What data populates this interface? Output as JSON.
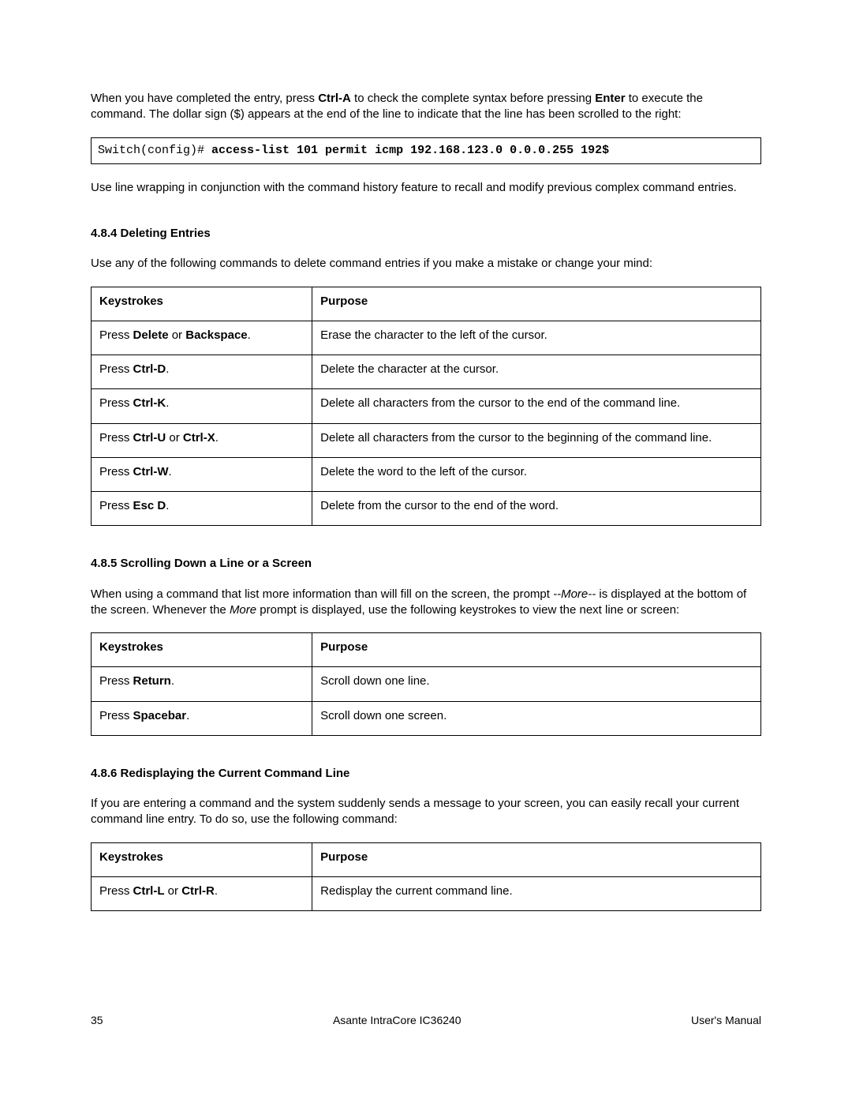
{
  "intro": {
    "p1_pre": "When you have completed the entry, press ",
    "p1_key1": "Ctrl-A",
    "p1_mid": " to check the complete syntax before pressing ",
    "p1_key2": "Enter",
    "p1_post": " to execute the command. The dollar sign ($) appears at the end of the line to indicate that the line has been scrolled to the right:"
  },
  "codebox": {
    "prompt": "Switch(config)# ",
    "command": "access-list 101 permit icmp 192.168.123.0 0.0.0.255 192$"
  },
  "after_code": " Use line wrapping in conjunction with the command history feature to recall and modify previous complex command entries.",
  "section484": {
    "heading": "4.8.4 Deleting Entries",
    "intro": "Use any of the following commands to delete command entries if you make a mistake or change your mind:",
    "headers": {
      "k": "Keystrokes",
      "p": "Purpose"
    },
    "rows": [
      {
        "k_pre": "Press ",
        "k_bold": "Delete",
        "k_mid": " or ",
        "k_bold2": "Backspace",
        "k_post": ".",
        "purpose": "Erase the character to the left of the cursor."
      },
      {
        "k_pre": "Press ",
        "k_bold": "Ctrl-D",
        "k_mid": "",
        "k_bold2": "",
        "k_post": ".",
        "purpose": "Delete the character at the cursor."
      },
      {
        "k_pre": "Press ",
        "k_bold": "Ctrl-K",
        "k_mid": "",
        "k_bold2": "",
        "k_post": ".",
        "purpose": "Delete all characters from the cursor to the end of the command line."
      },
      {
        "k_pre": "Press ",
        "k_bold": "Ctrl-U",
        "k_mid": " or ",
        "k_bold2": "Ctrl-X",
        "k_post": ".",
        "purpose": "Delete all characters from the cursor to the beginning of the command line."
      },
      {
        "k_pre": "Press ",
        "k_bold": "Ctrl-W",
        "k_mid": "",
        "k_bold2": "",
        "k_post": ".",
        "purpose": "Delete the word to the left of the cursor."
      },
      {
        "k_pre": "Press ",
        "k_bold": "Esc D",
        "k_mid": "",
        "k_bold2": "",
        "k_post": ".",
        "purpose": "Delete from the cursor to the end of the word."
      }
    ]
  },
  "section485": {
    "heading": "4.8.5 Scrolling Down a Line or a Screen",
    "intro_pre": "When using a command that list more information than will fill on the screen, the prompt ",
    "intro_more1": "--More--",
    "intro_mid": " is displayed at the bottom of the screen. Whenever the ",
    "intro_more2": "More",
    "intro_post": " prompt is displayed, use the following keystrokes to view the next line or screen:",
    "headers": {
      "k": "Keystrokes",
      "p": "Purpose"
    },
    "rows": [
      {
        "k_pre": "Press ",
        "k_bold": "Return",
        "k_post": ".",
        "purpose": "Scroll down one line."
      },
      {
        "k_pre": "Press ",
        "k_bold": "Spacebar",
        "k_post": ".",
        "purpose": "Scroll down one screen."
      }
    ]
  },
  "section486": {
    "heading": "4.8.6 Redisplaying the Current Command Line",
    "intro": "If you are entering a command and the system suddenly sends a message to your screen, you can easily recall your current command line entry. To do so, use the following command:",
    "headers": {
      "k": "Keystrokes",
      "p": "Purpose"
    },
    "rows": [
      {
        "k_pre": "Press ",
        "k_bold": "Ctrl-L",
        "k_mid": " or ",
        "k_bold2": "Ctrl-R",
        "k_post": ".",
        "purpose": "Redisplay the current command line."
      }
    ]
  },
  "footer": {
    "page": "35",
    "center": "Asante IntraCore IC36240",
    "right": "User's Manual"
  }
}
